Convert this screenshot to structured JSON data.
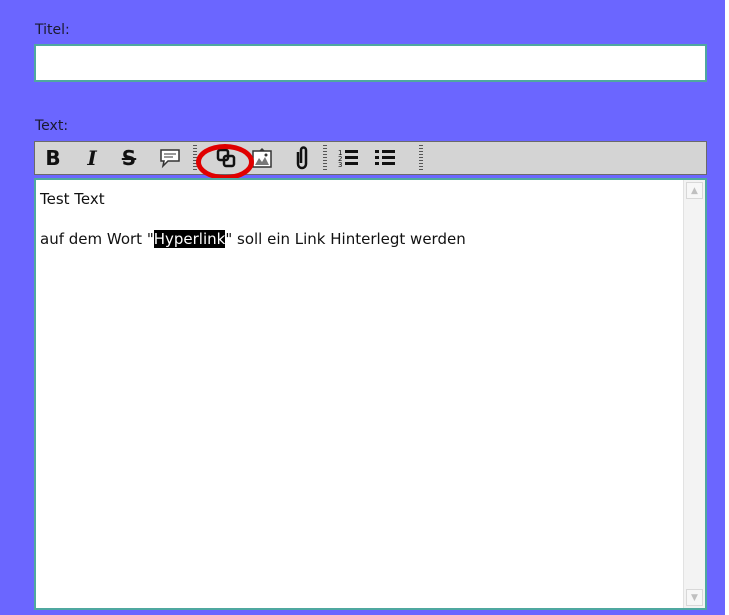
{
  "form": {
    "title_label": "Titel:",
    "title_value": "",
    "text_label": "Text:"
  },
  "toolbar": {
    "bold_label": "B",
    "italic_label": "I",
    "strike_label": "S",
    "icons": [
      "bold-icon",
      "italic-icon",
      "strikethrough-icon",
      "comment-icon",
      "link-icon",
      "image-icon",
      "attachment-icon",
      "ordered-list-icon",
      "unordered-list-icon"
    ],
    "highlighted_button": "link-icon",
    "highlight_color": "#e00000"
  },
  "editor": {
    "line1": "Test Text",
    "line3_before": "auf dem Wort \"",
    "line3_selected": "Hyperlink",
    "line3_after": "\" soll ein Link Hinterlegt werden"
  },
  "colors": {
    "background": "#6b66ff",
    "field_border": "#4fa8a0",
    "toolbar": "#d4d4d4"
  }
}
